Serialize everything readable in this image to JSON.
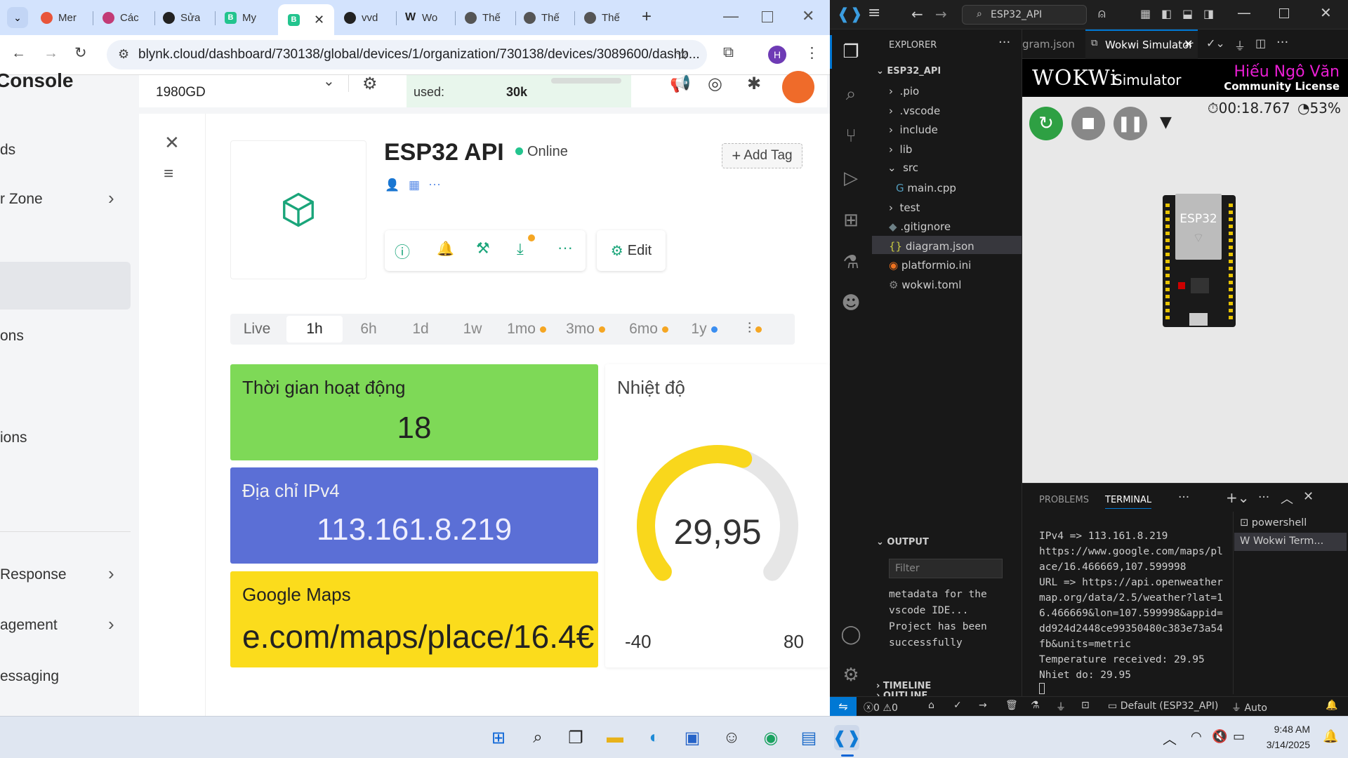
{
  "browser": {
    "tabs": [
      {
        "label": "Mer",
        "color": "#e8553a"
      },
      {
        "label": "Các",
        "color": "#c23b76"
      },
      {
        "label": "Sửa",
        "color": "#222222"
      },
      {
        "label": "My",
        "color": "#23c48e"
      },
      {
        "label": "",
        "color": "#23c48e"
      },
      {
        "label": "vvd",
        "color": "#222222"
      },
      {
        "label": "Wo",
        "color": "#222222"
      },
      {
        "label": "Thế",
        "color": "#555555"
      },
      {
        "label": "Thế",
        "color": "#555555"
      },
      {
        "label": "Thế",
        "color": "#555555"
      }
    ],
    "url": "blynk.cloud/dashboard/730138/global/devices/1/organization/730138/devices/3089600/dashb...",
    "profile_initial": "H"
  },
  "blynk": {
    "brand": "Console",
    "nav": [
      "ds",
      "r Zone",
      "ons",
      "ions",
      "Response",
      "agement",
      "essaging"
    ],
    "org_name": "1980GD",
    "used_label": "used:",
    "used_value": "30k",
    "device_name": "ESP32 API",
    "status": "Online",
    "add_tag": "Add Tag",
    "edit": "Edit",
    "ranges": [
      "Live",
      "1h",
      "6h",
      "1d",
      "1w",
      "1mo",
      "3mo",
      "6mo",
      "1y"
    ],
    "active_range": "1h",
    "widgets": {
      "uptime": {
        "title": "Thời gian hoạt động",
        "value": "18",
        "color": "#7ed957"
      },
      "ip": {
        "title": "Địa chỉ IPv4",
        "value": "113.161.8.219",
        "color": "#5b6fd6"
      },
      "maps": {
        "title": "Google Maps",
        "value": "e.com/maps/place/16.4€",
        "color": "#fbdc1c"
      },
      "temp": {
        "title": "Nhiệt độ",
        "value": "29,95",
        "min": "-40",
        "max": "80",
        "gauge_fraction": 0.58,
        "color": "#f9d71c"
      }
    }
  },
  "vscode": {
    "search": "ESP32_API",
    "explorer_title": "EXPLORER",
    "project": "ESP32_API",
    "tree": [
      ".pio",
      ".vscode",
      "include",
      "lib",
      "src",
      "main.cpp",
      "test",
      ".gitignore",
      "diagram.json",
      "platformio.ini",
      "wokwi.toml"
    ],
    "tabs": [
      "gram.json",
      "Wokwi Simulator"
    ],
    "wokwi_brand": "WOKWi",
    "simulator": "Simulator",
    "user": "Hiếu Ngô Văn",
    "license": "Community License",
    "timer": "00:18.767",
    "speed": "53%",
    "chip_label": "ESP32",
    "output_title": "OUTPUT",
    "filter_placeholder": "Filter",
    "output_text": "metadata for the vscode IDE... Project has been successfully",
    "outline": "OUTLINE",
    "timeline": "TIMELINE",
    "panel_tabs": [
      "PROBLEMS",
      "TERMINAL"
    ],
    "terminals": [
      "powershell",
      "Wokwi Term..."
    ],
    "terminal_lines": "IPv4 => 113.161.8.219\nhttps://www.google.com/maps/place/16.466669,107.599998\nURL => https://api.openweathermap.org/data/2.5/weather?lat=16.466669&lon=107.599998&appid=dd924d2448ce99350480c383e73a54fb&units=metric\nTemperature received: 29.95\nNhiet do: 29.95",
    "status_errors": "0",
    "status_warnings": "0",
    "status_env": "Default (ESP32_API)",
    "status_auto": "Auto"
  },
  "taskbar": {
    "time": "9:48 AM",
    "date": "3/14/2025"
  }
}
